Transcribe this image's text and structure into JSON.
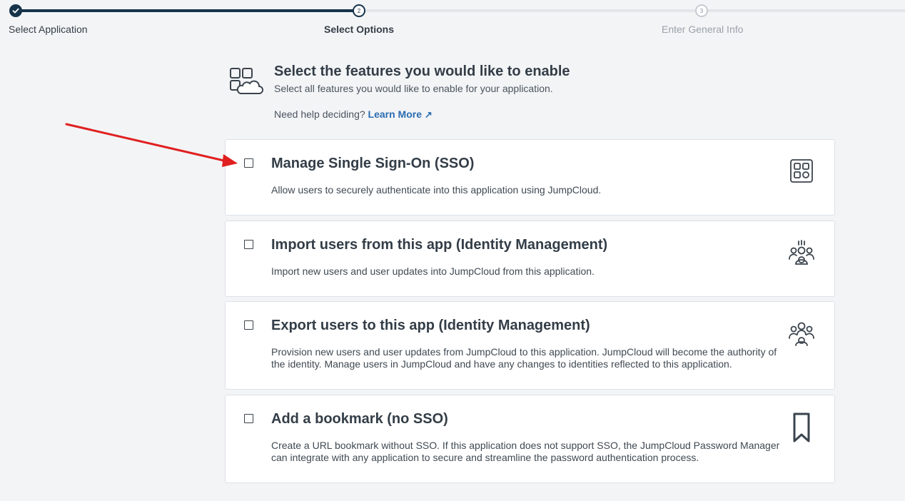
{
  "stepper": {
    "steps": [
      {
        "number": "",
        "label": "Select Application",
        "state": "done"
      },
      {
        "number": "2",
        "label": "Select Options",
        "state": "current"
      },
      {
        "number": "3",
        "label": "Enter General Info",
        "state": "upcoming"
      }
    ]
  },
  "header": {
    "title": "Select the features you would like to enable",
    "subtitle": "Select all features you would like to enable for your application.",
    "help_text": "Need help deciding?",
    "learn_more": "Learn More",
    "learn_more_icon": "external-link-icon"
  },
  "features": [
    {
      "title": "Manage Single Sign-On (SSO)",
      "description": "Allow users to securely authenticate into this application using JumpCloud.",
      "checked": false,
      "icon": "apps-grid-icon"
    },
    {
      "title": "Import users from this app (Identity Management)",
      "description": "Import new users and user updates into JumpCloud from this application.",
      "checked": false,
      "icon": "import-users-icon"
    },
    {
      "title": "Export users to this app (Identity Management)",
      "description": "Provision new users and user updates from JumpCloud to this application. JumpCloud will become the authority of the identity. Manage users in JumpCloud and have any changes to identities reflected to this application.",
      "checked": false,
      "icon": "export-users-icon"
    },
    {
      "title": "Add a bookmark (no SSO)",
      "description": "Create a URL bookmark without SSO. If this application does not support SSO, the JumpCloud Password Manager can integrate with any application to secure and streamline the password authentication process.",
      "checked": false,
      "icon": "bookmark-icon"
    }
  ],
  "colors": {
    "accent": "#15334a",
    "link": "#2b6cb0",
    "annotation_arrow": "#e02020"
  }
}
